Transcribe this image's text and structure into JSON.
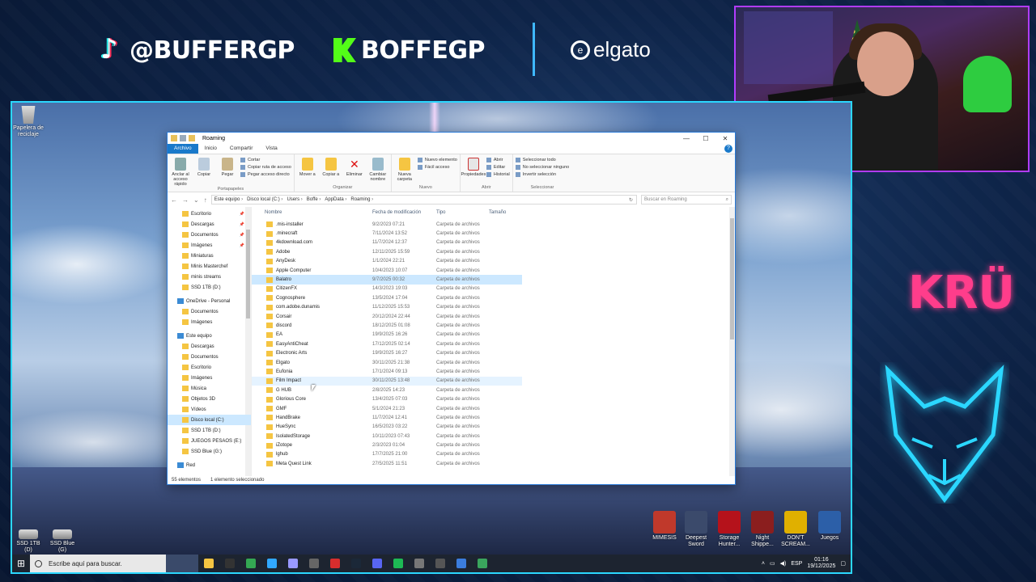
{
  "overlay": {
    "tiktok_handle": "@BUFFERGP",
    "kick_handle": "BOFFEGP",
    "sponsor": "elgato",
    "brand_logo": "KRÜ",
    "colors": {
      "frame": "#2bd7ff",
      "cam_border": "#b13cff",
      "kru": "#ff3d8b",
      "kick": "#53fc18"
    }
  },
  "desktop": {
    "recycle_bin": "Papelera de reciclaje",
    "drives": [
      "SSD 1TB (D)",
      "SSD Blue (G)"
    ],
    "game_icons": [
      {
        "label": "MIMESIS",
        "color": "#c0392b"
      },
      {
        "label": "Deepest Sword",
        "color": "#3b4a6b"
      },
      {
        "label": "Storage Hunter...",
        "color": "#b5121b"
      },
      {
        "label": "Night Shippe...",
        "color": "#8b1e1e"
      },
      {
        "label": "DON'T SCREAM...",
        "color": "#e0b000"
      },
      {
        "label": "Juegos",
        "color": "#2c5fa8"
      }
    ]
  },
  "taskbar": {
    "search_placeholder": "Escribe aquí para buscar.",
    "apps": [
      {
        "icon": "explorer-icon",
        "color": "#f5c542"
      },
      {
        "icon": "obs-icon",
        "color": "#333"
      },
      {
        "icon": "chrome-icon",
        "color": "#34a853"
      },
      {
        "icon": "photoshop-icon",
        "color": "#31a8ff"
      },
      {
        "icon": "premiere-icon",
        "color": "#9999ff"
      },
      {
        "icon": "elgato-icon",
        "color": "#666"
      },
      {
        "icon": "app-red-icon",
        "color": "#d62d2d"
      },
      {
        "icon": "steam-icon",
        "color": "#1b2838"
      },
      {
        "icon": "discord-icon",
        "color": "#5865f2"
      },
      {
        "icon": "spotify-icon",
        "color": "#1db954"
      },
      {
        "icon": "app-gray-icon",
        "color": "#777"
      },
      {
        "icon": "app-gray2-icon",
        "color": "#555"
      },
      {
        "icon": "app-blue-icon",
        "color": "#3b7ddd"
      },
      {
        "icon": "app-green-icon",
        "color": "#3aa55d"
      }
    ],
    "language": "ESP",
    "time": "01:16",
    "date": "19/12/2025"
  },
  "explorer": {
    "title": "Roaming",
    "tabs": [
      "Archivo",
      "Inicio",
      "Compartir",
      "Vista"
    ],
    "ribbon": {
      "portapapeles": {
        "pin": "Anclar al acceso rápido",
        "copy": "Copiar",
        "paste": "Pegar",
        "cut": "Cortar",
        "copy_path": "Copiar ruta de acceso",
        "paste_shortcut": "Pegar acceso directo",
        "label": "Portapapeles"
      },
      "organizar": {
        "move": "Mover a",
        "copy_to": "Copiar a",
        "delete": "Eliminar",
        "rename": "Cambiar nombre",
        "label": "Organizar"
      },
      "nuevo": {
        "new_folder": "Nueva carpeta",
        "new_item": "Nuevo elemento",
        "easy_access": "Fácil acceso",
        "label": "Nuevo"
      },
      "abrir": {
        "properties": "Propiedades",
        "open": "Abrir",
        "edit": "Editar",
        "history": "Historial",
        "label": "Abrir"
      },
      "seleccionar": {
        "select_all": "Seleccionar todo",
        "select_none": "No seleccionar ninguno",
        "invert": "Invertir selección",
        "label": "Seleccionar"
      }
    },
    "breadcrumb": [
      "Este equipo",
      "Disco local (C:)",
      "Users",
      "Boffe",
      "AppData",
      "Roaming"
    ],
    "search_placeholder": "Buscar en Roaming",
    "nav": [
      {
        "label": "Escritorio",
        "pinned": true,
        "type": "item"
      },
      {
        "label": "Descargas",
        "pinned": true,
        "type": "item"
      },
      {
        "label": "Documentos",
        "pinned": true,
        "type": "item"
      },
      {
        "label": "Imágenes",
        "pinned": true,
        "type": "item"
      },
      {
        "label": "Miniaturas",
        "pinned": false,
        "type": "item"
      },
      {
        "label": "Minis Masterchef",
        "pinned": false,
        "type": "item"
      },
      {
        "label": "minis streams",
        "pinned": false,
        "type": "item"
      },
      {
        "label": "SSD 1TB (D:)",
        "pinned": false,
        "type": "item"
      },
      {
        "label": "OneDrive - Personal",
        "pinned": false,
        "type": "section"
      },
      {
        "label": "Documentos",
        "pinned": false,
        "type": "item"
      },
      {
        "label": "Imágenes",
        "pinned": false,
        "type": "item"
      },
      {
        "label": "Este equipo",
        "pinned": false,
        "type": "section"
      },
      {
        "label": "Descargas",
        "pinned": false,
        "type": "item"
      },
      {
        "label": "Documentos",
        "pinned": false,
        "type": "item"
      },
      {
        "label": "Escritorio",
        "pinned": false,
        "type": "item"
      },
      {
        "label": "Imágenes",
        "pinned": false,
        "type": "item"
      },
      {
        "label": "Música",
        "pinned": false,
        "type": "item"
      },
      {
        "label": "Objetos 3D",
        "pinned": false,
        "type": "item"
      },
      {
        "label": "Vídeos",
        "pinned": false,
        "type": "item"
      },
      {
        "label": "Disco local (C:)",
        "pinned": false,
        "type": "item",
        "selected": true
      },
      {
        "label": "SSD 1TB (D:)",
        "pinned": false,
        "type": "item"
      },
      {
        "label": "JUEGOS PESAOS (E:)",
        "pinned": false,
        "type": "item"
      },
      {
        "label": "SSD Blue (G:)",
        "pinned": false,
        "type": "item"
      },
      {
        "label": "Red",
        "pinned": false,
        "type": "section"
      }
    ],
    "columns": [
      "Nombre",
      "Fecha de modificación",
      "Tipo",
      "Tamaño"
    ],
    "rows": [
      {
        "name": ".mis-installer",
        "date": "9/2/2023 07:21",
        "type": "Carpeta de archivos"
      },
      {
        "name": ".minecraft",
        "date": "7/11/2024 13:52",
        "type": "Carpeta de archivos"
      },
      {
        "name": "4kdownload.com",
        "date": "11/7/2024 12:37",
        "type": "Carpeta de archivos"
      },
      {
        "name": "Adobe",
        "date": "12/11/2025 15:59",
        "type": "Carpeta de archivos"
      },
      {
        "name": "AnyDesk",
        "date": "1/1/2024 22:21",
        "type": "Carpeta de archivos"
      },
      {
        "name": "Apple Computer",
        "date": "10/4/2023 10:07",
        "type": "Carpeta de archivos"
      },
      {
        "name": "Balatro",
        "date": "9/7/2025 00:32",
        "type": "Carpeta de archivos",
        "selected": true
      },
      {
        "name": "CitizenFX",
        "date": "14/3/2023 19:03",
        "type": "Carpeta de archivos"
      },
      {
        "name": "Cognosphere",
        "date": "13/5/2024 17:04",
        "type": "Carpeta de archivos"
      },
      {
        "name": "com.adobe.dunamis",
        "date": "11/12/2025 15:53",
        "type": "Carpeta de archivos"
      },
      {
        "name": "Corsair",
        "date": "20/12/2024 22:44",
        "type": "Carpeta de archivos"
      },
      {
        "name": "discord",
        "date": "18/12/2025 01:08",
        "type": "Carpeta de archivos"
      },
      {
        "name": "EA",
        "date": "19/9/2025 16:26",
        "type": "Carpeta de archivos"
      },
      {
        "name": "EasyAntiCheat",
        "date": "17/12/2025 02:14",
        "type": "Carpeta de archivos"
      },
      {
        "name": "Electronic Arts",
        "date": "19/9/2025 16:27",
        "type": "Carpeta de archivos"
      },
      {
        "name": "Elgato",
        "date": "30/11/2025 21:38",
        "type": "Carpeta de archivos"
      },
      {
        "name": "Eufonia",
        "date": "17/1/2024 09:13",
        "type": "Carpeta de archivos"
      },
      {
        "name": "Film Impact",
        "date": "30/11/2025 13:48",
        "type": "Carpeta de archivos",
        "hover": true
      },
      {
        "name": "G HUB",
        "date": "2/8/2025 14:23",
        "type": "Carpeta de archivos"
      },
      {
        "name": "Glorious Core",
        "date": "13/4/2025 07:03",
        "type": "Carpeta de archivos"
      },
      {
        "name": "GMF",
        "date": "5/1/2024 21:23",
        "type": "Carpeta de archivos"
      },
      {
        "name": "HandBrake",
        "date": "11/7/2024 12:41",
        "type": "Carpeta de archivos"
      },
      {
        "name": "HueSync",
        "date": "16/5/2023 03:22",
        "type": "Carpeta de archivos"
      },
      {
        "name": "IsolatedStorage",
        "date": "10/11/2023 07:43",
        "type": "Carpeta de archivos"
      },
      {
        "name": "iZotope",
        "date": "2/3/2023 01:04",
        "type": "Carpeta de archivos"
      },
      {
        "name": "lghub",
        "date": "17/7/2025 21:00",
        "type": "Carpeta de archivos"
      },
      {
        "name": "Meta Quest Link",
        "date": "27/5/2025 11:51",
        "type": "Carpeta de archivos"
      }
    ],
    "status": {
      "count": "55 elementos",
      "selection": "1 elemento seleccionado"
    }
  }
}
